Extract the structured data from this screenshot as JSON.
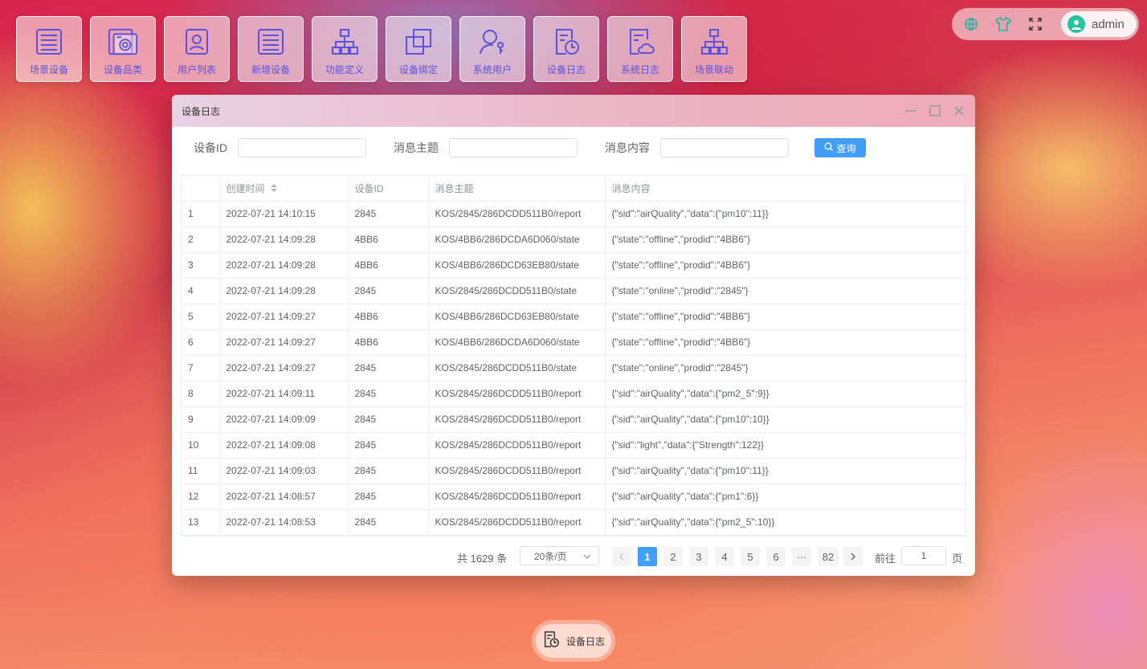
{
  "desktop_icons": [
    {
      "label": "场景设备",
      "icon": "list-icon"
    },
    {
      "label": "设备品类",
      "icon": "washer-icon"
    },
    {
      "label": "用户列表",
      "icon": "user-card-icon"
    },
    {
      "label": "新增设备",
      "icon": "list-icon"
    },
    {
      "label": "功能定义",
      "icon": "hierarchy-icon"
    },
    {
      "label": "设备绑定",
      "icon": "copy-icon"
    },
    {
      "label": "系统用户",
      "icon": "user-key-icon"
    },
    {
      "label": "设备日志",
      "icon": "doc-clock-icon"
    },
    {
      "label": "系统日志",
      "icon": "doc-cloud-icon"
    },
    {
      "label": "场景联动",
      "icon": "hierarchy-icon"
    }
  ],
  "topbar": {
    "icons": [
      "globe-icon",
      "shirt-icon",
      "fullscreen-icon"
    ],
    "user": "admin"
  },
  "window": {
    "title": "设备日志",
    "search": {
      "device_id_label": "设备ID",
      "device_id_value": "",
      "topic_label": "消息主题",
      "topic_value": "",
      "content_label": "消息内容",
      "content_value": "",
      "query_label": "查询"
    },
    "table": {
      "columns": [
        "",
        "创建时间",
        "设备ID",
        "消息主题",
        "消息内容"
      ],
      "rows": [
        [
          "1",
          "2022-07-21 14:10:15",
          "2845",
          "KOS/2845/286DCDD511B0/report",
          "{\"sid\":\"airQuality\",\"data\":{\"pm10\":11}}"
        ],
        [
          "2",
          "2022-07-21 14:09:28",
          "4BB6",
          "KOS/4BB6/286DCDA6D060/state",
          "{\"state\":\"offline\",\"prodid\":\"4BB6\"}"
        ],
        [
          "3",
          "2022-07-21 14:09:28",
          "4BB6",
          "KOS/4BB6/286DCD63EB80/state",
          "{\"state\":\"offline\",\"prodid\":\"4BB6\"}"
        ],
        [
          "4",
          "2022-07-21 14:09:28",
          "2845",
          "KOS/2845/286DCDD511B0/state",
          "{\"state\":\"online\",\"prodid\":\"2845\"}"
        ],
        [
          "5",
          "2022-07-21 14:09:27",
          "4BB6",
          "KOS/4BB6/286DCD63EB80/state",
          "{\"state\":\"offline\",\"prodid\":\"4BB6\"}"
        ],
        [
          "6",
          "2022-07-21 14:09:27",
          "4BB6",
          "KOS/4BB6/286DCDA6D060/state",
          "{\"state\":\"offline\",\"prodid\":\"4BB6\"}"
        ],
        [
          "7",
          "2022-07-21 14:09:27",
          "2845",
          "KOS/2845/286DCDD511B0/state",
          "{\"state\":\"online\",\"prodid\":\"2845\"}"
        ],
        [
          "8",
          "2022-07-21 14:09:11",
          "2845",
          "KOS/2845/286DCDD511B0/report",
          "{\"sid\":\"airQuality\",\"data\":{\"pm2_5\":9}}"
        ],
        [
          "9",
          "2022-07-21 14:09:09",
          "2845",
          "KOS/2845/286DCDD511B0/report",
          "{\"sid\":\"airQuality\",\"data\":{\"pm10\":10}}"
        ],
        [
          "10",
          "2022-07-21 14:09:08",
          "2845",
          "KOS/2845/286DCDD511B0/report",
          "{\"sid\":\"light\",\"data\":{\"Strength\":122}}"
        ],
        [
          "11",
          "2022-07-21 14:09:03",
          "2845",
          "KOS/2845/286DCDD511B0/report",
          "{\"sid\":\"airQuality\",\"data\":{\"pm10\":11}}"
        ],
        [
          "12",
          "2022-07-21 14:08:57",
          "2845",
          "KOS/2845/286DCDD511B0/report",
          "{\"sid\":\"airQuality\",\"data\":{\"pm1\":6}}"
        ],
        [
          "13",
          "2022-07-21 14:08:53",
          "2845",
          "KOS/2845/286DCDD511B0/report",
          "{\"sid\":\"airQuality\",\"data\":{\"pm2_5\":10}}"
        ]
      ]
    },
    "pager": {
      "total": "共 1629 条",
      "page_size": "20条/页",
      "pages": [
        "1",
        "2",
        "3",
        "4",
        "5",
        "6",
        "···",
        "82"
      ],
      "current": "1",
      "goto_label": "前往",
      "goto_value": "1",
      "goto_unit": "页"
    }
  },
  "taskbar": {
    "label": "设备日志",
    "icon": "doc-clock-icon"
  },
  "colors": {
    "accent": "#409eff",
    "icon_purple": "#5b52e0",
    "avatar": "#27c2a2"
  }
}
